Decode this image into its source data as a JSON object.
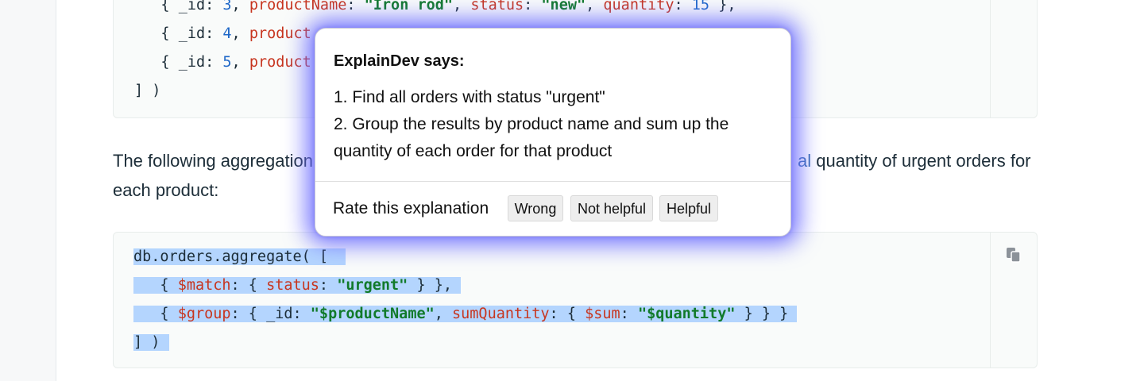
{
  "top_code": {
    "lines": [
      {
        "indent": "   ",
        "id_label": "_id",
        "id": "3",
        "product_key": "productName",
        "product": "\"Iron rod\"",
        "status_key": "status",
        "status": "\"new\"",
        "qty_key": "quantity",
        "qty": "15",
        "tail": " },"
      },
      {
        "indent": "   ",
        "id_label": "_id",
        "id": "4",
        "product_key": "product"
      },
      {
        "indent": "   ",
        "id_label": "_id",
        "id": "5",
        "product_key": "product"
      }
    ],
    "close": "] )"
  },
  "paragraph": {
    "left_text": "The following aggregation",
    "right_text_highlight": "al",
    "right_text": " quantity of urgent orders for",
    "second_line": "each product:"
  },
  "bottom_code": {
    "line1": "db.orders.aggregate( [",
    "line2": {
      "match_key": "$match",
      "status_key": "status",
      "status": "\"urgent\""
    },
    "line3": {
      "group_key": "$group",
      "id_key": "_id",
      "id": "\"$productName\"",
      "sum_q_key": "sumQuantity",
      "sum_key": "$sum",
      "sum": "\"$quantity\""
    },
    "line4": "] )"
  },
  "popup": {
    "title": "ExplainDev says:",
    "step1": "1. Find all orders with status \"urgent\"",
    "step2": "2. Group the results by product name and sum up the",
    "step2b": "quantity of each order for that product",
    "rate_label": "Rate this explanation",
    "buttons": {
      "wrong": "Wrong",
      "not_helpful": "Not helpful",
      "helpful": "Helpful"
    }
  },
  "icons": {
    "copy": "copy-icon"
  },
  "colors": {
    "glow": "#6e6eff",
    "selection": "#b4d5fe",
    "keyword": "#c7351f",
    "string": "#117a2a",
    "number": "#1f68c8"
  }
}
